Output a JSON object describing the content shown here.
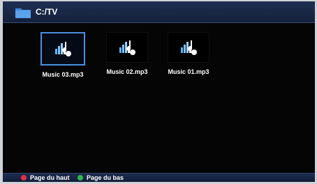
{
  "header": {
    "path": "C:/TV",
    "icon": "folder-icon"
  },
  "files": [
    {
      "name": "Music 03.mp3",
      "icon": "music-file-icon",
      "selected": true
    },
    {
      "name": "Music 02.mp3",
      "icon": "music-file-icon",
      "selected": false
    },
    {
      "name": "Music 01.mp3",
      "icon": "music-file-icon",
      "selected": false
    }
  ],
  "footer": {
    "red_hint": "Page du haut",
    "green_hint": "Page du bas",
    "red_color": "#e0304a",
    "green_color": "#2fb84a"
  },
  "colors": {
    "selection": "#4a8fe0",
    "bar": "#1a2a4a"
  }
}
